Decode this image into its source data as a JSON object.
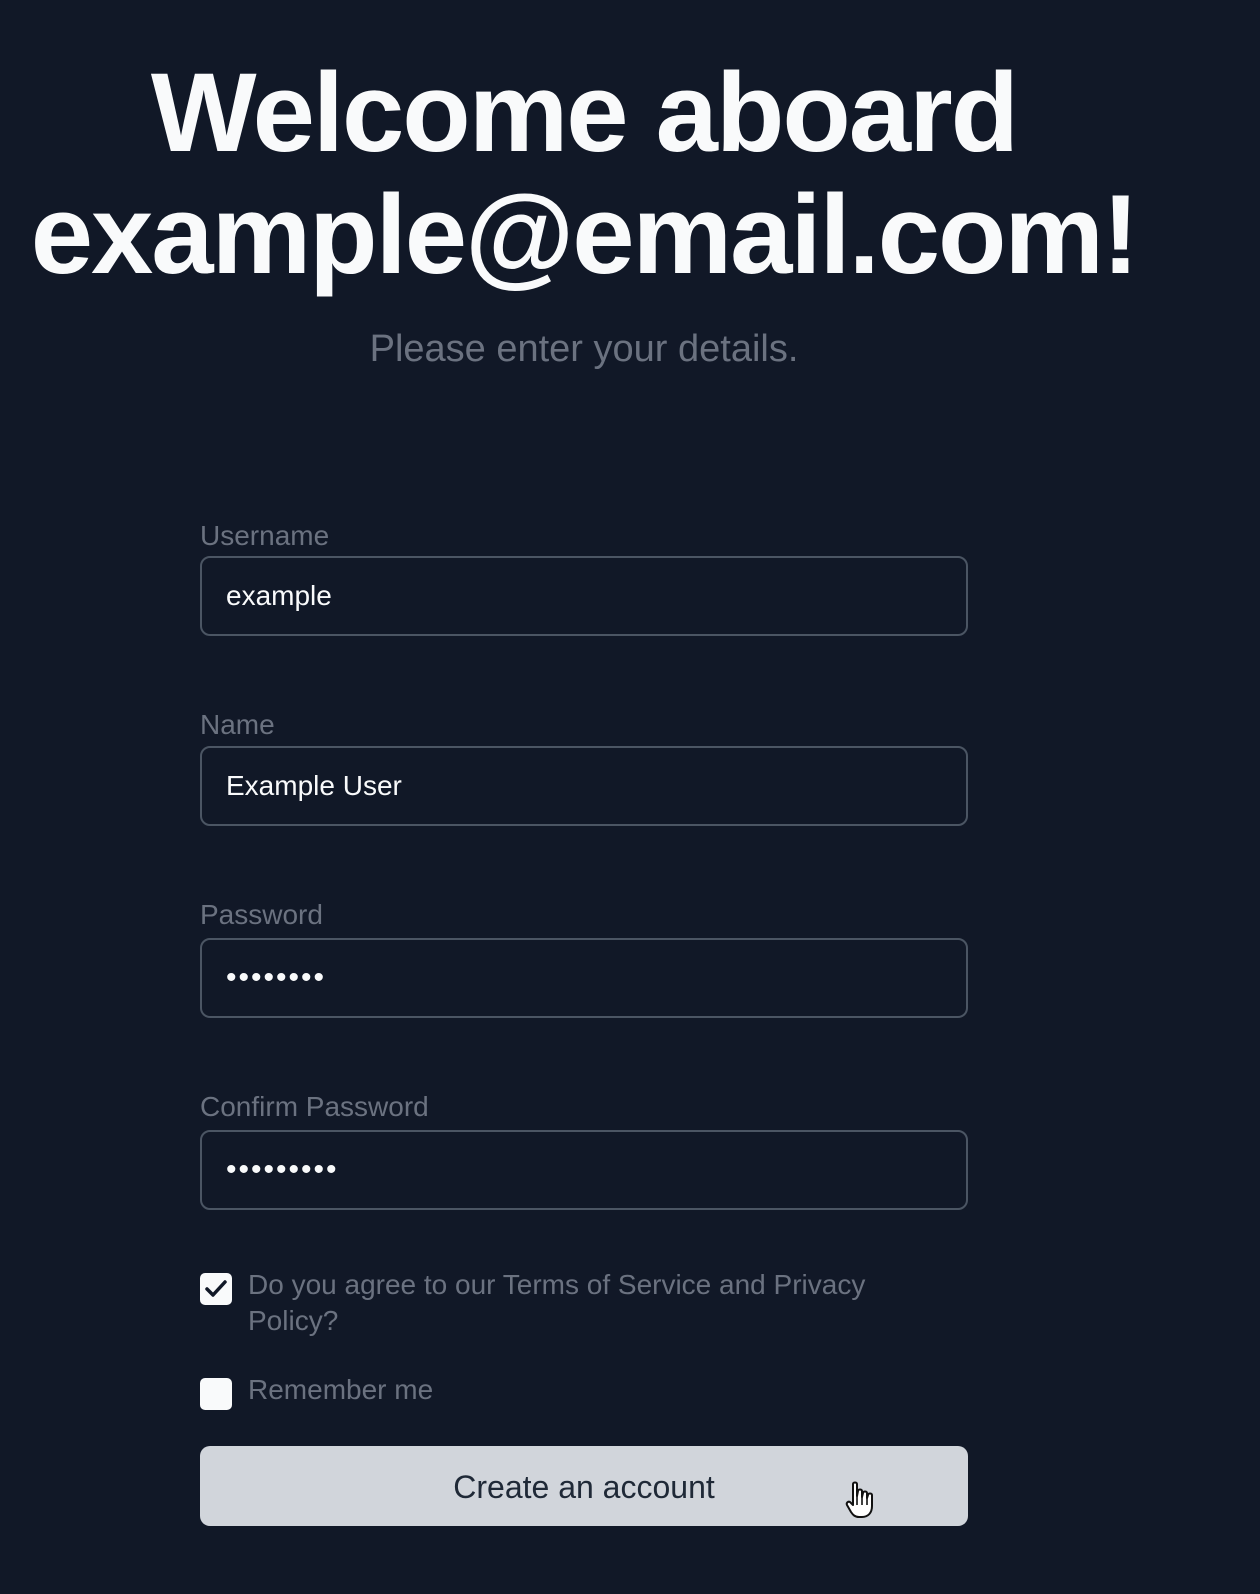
{
  "header": {
    "title_line1": "Welcome aboard",
    "title_line2": "example@email.com!",
    "subtitle": "Please enter your details."
  },
  "form": {
    "username": {
      "label": "Username",
      "value": "example"
    },
    "name": {
      "label": "Name",
      "value": "Example User"
    },
    "password": {
      "label": "Password",
      "value": "••••••••"
    },
    "confirm_password": {
      "label": "Confirm Password",
      "value": "•••••••••"
    },
    "terms": {
      "label": "Do you agree to our Terms of Service and Privacy Policy?",
      "checked": true
    },
    "remember": {
      "label": "Remember me",
      "checked": false
    },
    "submit_label": "Create an account"
  },
  "icons": {
    "checkmark": "check-icon",
    "cursor": "hand-pointer-icon"
  },
  "colors": {
    "background": "#111827",
    "heading": "#f9fafb",
    "muted_text": "#6b7280",
    "input_border": "#4b5563",
    "button_bg": "#d1d5db",
    "button_text": "#1f2937"
  }
}
